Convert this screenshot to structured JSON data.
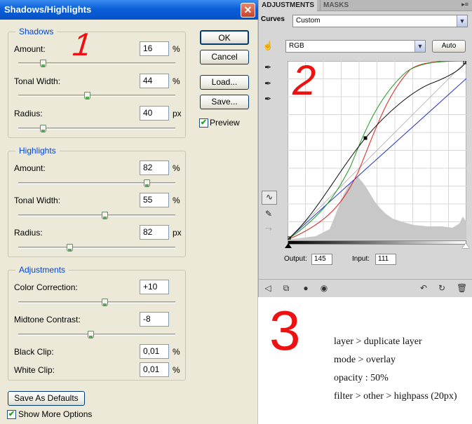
{
  "dialog": {
    "title": "Shadows/Highlights",
    "close_glyph": "✕",
    "shadows": {
      "legend": "Shadows",
      "amount": {
        "label": "Amount:",
        "value": "16",
        "unit": "%",
        "fraction": 0.16
      },
      "tonal_width": {
        "label": "Tonal Width:",
        "value": "44",
        "unit": "%",
        "fraction": 0.44
      },
      "radius": {
        "label": "Radius:",
        "value": "40",
        "unit": "px",
        "fraction": 0.16
      }
    },
    "highlights": {
      "legend": "Highlights",
      "amount": {
        "label": "Amount:",
        "value": "82",
        "unit": "%",
        "fraction": 0.82
      },
      "tonal_width": {
        "label": "Tonal Width:",
        "value": "55",
        "unit": "%",
        "fraction": 0.55
      },
      "radius": {
        "label": "Radius:",
        "value": "82",
        "unit": "px",
        "fraction": 0.33
      }
    },
    "adjustments": {
      "legend": "Adjustments",
      "color_correction": {
        "label": "Color Correction:",
        "value": "+10",
        "fraction": 0.55
      },
      "midtone_contrast": {
        "label": "Midtone Contrast:",
        "value": "-8",
        "fraction": 0.46
      },
      "black_clip": {
        "label": "Black Clip:",
        "value": "0,01",
        "unit": "%"
      },
      "white_clip": {
        "label": "White Clip:",
        "value": "0,01",
        "unit": "%"
      }
    },
    "buttons": {
      "ok": "OK",
      "cancel": "Cancel",
      "load": "Load...",
      "save": "Save...",
      "save_defaults": "Save As Defaults"
    },
    "preview": {
      "label": "Preview",
      "checked": true
    },
    "show_more": {
      "label": "Show More Options",
      "checked": true
    }
  },
  "adjustments_panel": {
    "tabs": [
      "ADJUSTMENTS",
      "MASKS"
    ],
    "panel_menu_glyph": "▸≡",
    "preset_label": "Curves",
    "preset_value": "Custom",
    "channel": "RGB",
    "auto_label": "Auto",
    "output_label": "Output:",
    "output_value": "145",
    "input_label": "Input:",
    "input_value": "111"
  },
  "annotations": {
    "markers": [
      "1",
      "2",
      "3"
    ],
    "steps": [
      "layer > duplicate layer",
      "mode > overlay",
      "opacity : 50%",
      "filter > other > highpass (20px)"
    ]
  },
  "colors": {
    "red_marker": "#ee1111",
    "legend_blue": "#0046d5",
    "title_blue": "#0a5fd8"
  },
  "icons": [
    "close-icon",
    "checkmark-icon",
    "hand-target-icon",
    "eyedropper-icon",
    "curve-point-icon",
    "pencil-icon",
    "smooth-icon",
    "back-arrow-icon",
    "clip-icon",
    "layer-visibility-icon",
    "eye-icon",
    "reset-icon",
    "refresh-icon",
    "trash-icon",
    "dropdown-arrow-icon"
  ]
}
